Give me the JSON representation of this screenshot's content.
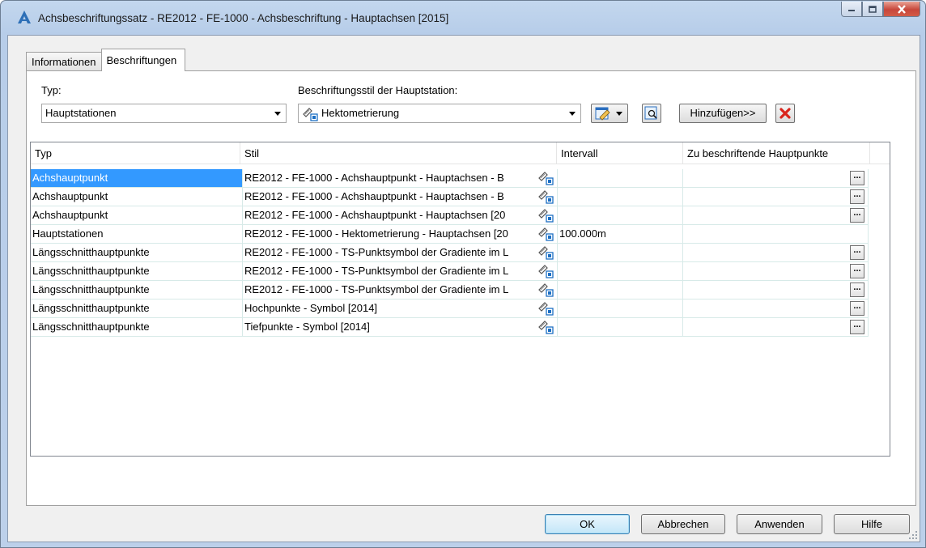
{
  "window": {
    "title": "Achsbeschriftungssatz - RE2012 - FE-1000 - Achsbeschriftung - Hauptachsen [2015]",
    "app_icon": "autocad-civil-icon",
    "minimize": "minimize-icon",
    "maximize": "maximize-icon",
    "close": "close-icon"
  },
  "tabs": [
    {
      "label": "Informationen",
      "active": false
    },
    {
      "label": "Beschriftungen",
      "active": true
    }
  ],
  "typ_label": "Typ:",
  "typ_value": "Hauptstationen",
  "style_label": "Beschriftungsstil der Hauptstation:",
  "style_value": "Hektometrierung",
  "add_button": "Hinzufügen>>",
  "table": {
    "columns": [
      "Typ",
      "Stil",
      "Intervall",
      "Zu beschriftende Hauptpunkte"
    ],
    "rows": [
      {
        "typ": "Achshauptpunkt",
        "stil": "RE2012 - FE-1000 - Achshauptpunkt - Hauptachsen - B",
        "intervall": "",
        "dots": true,
        "selected": true
      },
      {
        "typ": "Achshauptpunkt",
        "stil": "RE2012 - FE-1000 - Achshauptpunkt - Hauptachsen - B",
        "intervall": "",
        "dots": true,
        "selected": false
      },
      {
        "typ": "Achshauptpunkt",
        "stil": "RE2012 - FE-1000 - Achshauptpunkt - Hauptachsen [20",
        "intervall": "",
        "dots": true,
        "selected": false
      },
      {
        "typ": "Hauptstationen",
        "stil": "RE2012 - FE-1000 - Hektometrierung - Hauptachsen [20",
        "intervall": "100.000m",
        "dots": false,
        "selected": false
      },
      {
        "typ": "Längsschnitthauptpunkte",
        "stil": "RE2012 - FE-1000 - TS-Punktsymbol der Gradiente im L",
        "intervall": "",
        "dots": true,
        "selected": false
      },
      {
        "typ": "Längsschnitthauptpunkte",
        "stil": "RE2012 - FE-1000 - TS-Punktsymbol der Gradiente im L",
        "intervall": "",
        "dots": true,
        "selected": false
      },
      {
        "typ": "Längsschnitthauptpunkte",
        "stil": "RE2012 - FE-1000 - TS-Punktsymbol der Gradiente im L",
        "intervall": "",
        "dots": true,
        "selected": false
      },
      {
        "typ": "Längsschnitthauptpunkte",
        "stil": "Hochpunkte - Symbol [2014]",
        "intervall": "",
        "dots": true,
        "selected": false
      },
      {
        "typ": "Längsschnitthauptpunkte",
        "stil": "Tiefpunkte - Symbol [2014]",
        "intervall": "",
        "dots": true,
        "selected": false
      }
    ],
    "dots_label": "..."
  },
  "buttons": {
    "ok": "OK",
    "cancel": "Abbrechen",
    "apply": "Anwenden",
    "help": "Hilfe"
  },
  "colors": {
    "selection": "#3399ff",
    "grid_line": "#d7eae8",
    "delete_red": "#d9251d"
  }
}
